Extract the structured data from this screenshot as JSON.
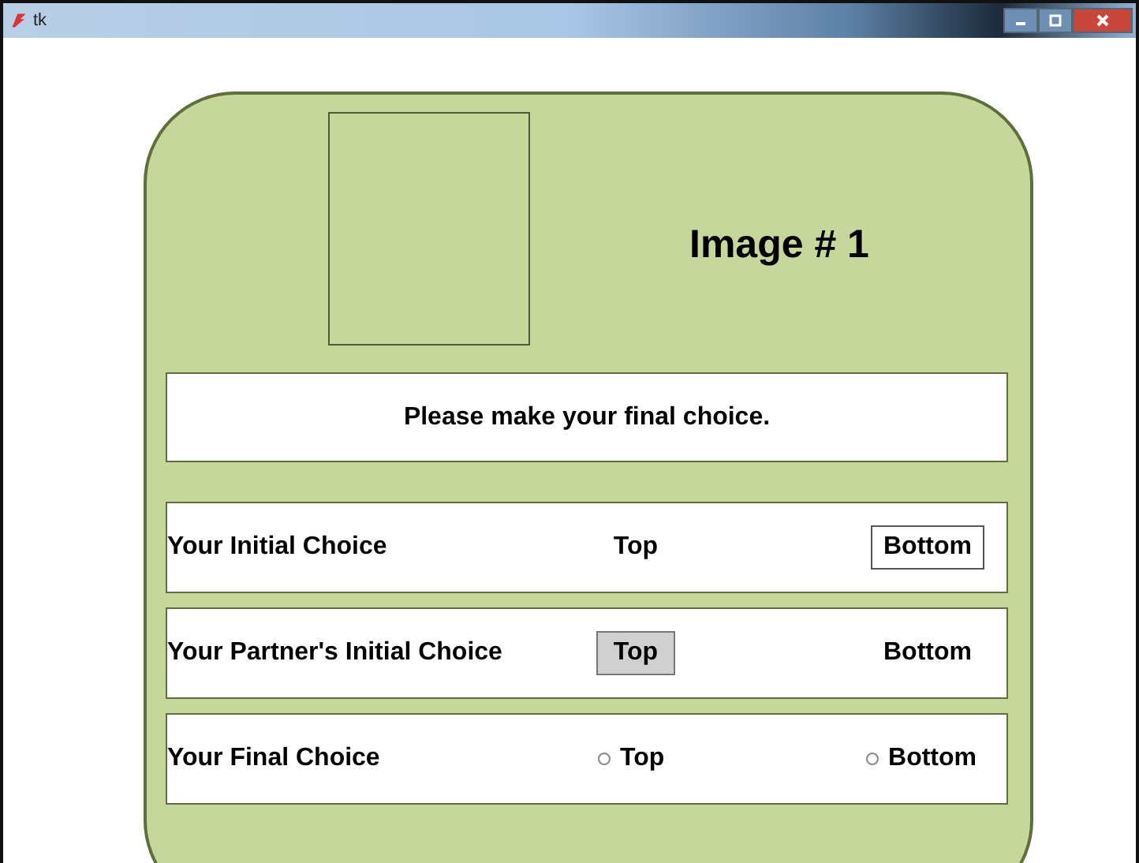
{
  "window": {
    "title": "tk"
  },
  "image_label": "Image # 1",
  "message": "Please make your final choice.",
  "rows": [
    {
      "kind": "initial",
      "label": "Your Initial Choice",
      "options": [
        {
          "label": "Top",
          "selected": false
        },
        {
          "label": "Bottom",
          "selected": true
        }
      ]
    },
    {
      "kind": "partner",
      "label": "Your Partner's Initial Choice",
      "options": [
        {
          "label": "Top",
          "selected": true
        },
        {
          "label": "Bottom",
          "selected": false
        }
      ]
    },
    {
      "kind": "radio",
      "label": "Your Final Choice",
      "options": [
        {
          "label": "Top",
          "selected": false
        },
        {
          "label": "Bottom",
          "selected": false
        }
      ]
    }
  ]
}
